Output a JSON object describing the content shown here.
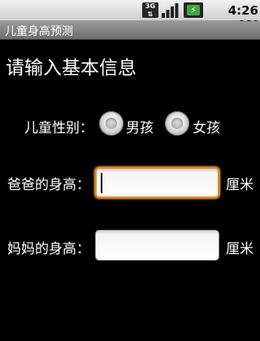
{
  "status_bar": {
    "network": "3G",
    "battery_icon": "battery-charging-icon",
    "signal_icon": "signal-strength-icon",
    "time": "4:26 AM"
  },
  "app": {
    "title": "儿童身高预测"
  },
  "form": {
    "heading": "请输入基本信息",
    "gender": {
      "label": "儿童性别：",
      "options": [
        "男孩",
        "女孩"
      ]
    },
    "father_height": {
      "label": "爸爸的身高：",
      "value": "",
      "unit": "厘米"
    },
    "mother_height": {
      "label": "妈妈的身高：",
      "value": "",
      "unit": "厘米"
    }
  },
  "colors": {
    "focus_ring": "#f0891a",
    "background": "#000000"
  }
}
